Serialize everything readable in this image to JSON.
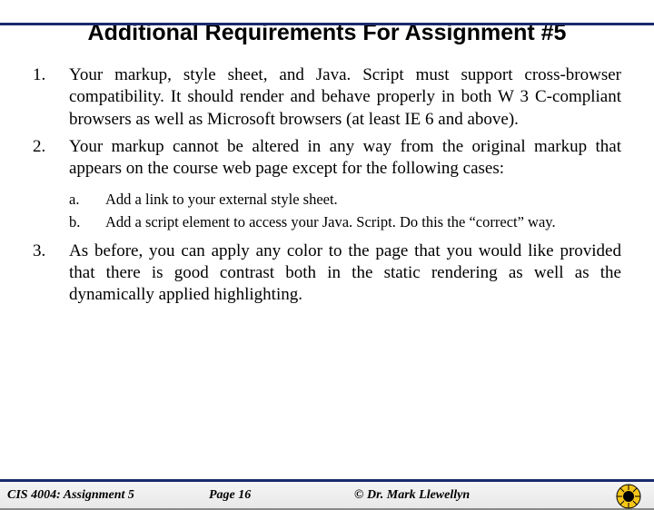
{
  "title": "Additional Requirements For Assignment #5",
  "items": [
    {
      "text": "Your markup, style sheet, and Java. Script must support cross-browser compatibility.  It should render and behave properly in both W 3 C-compliant browsers as well as Microsoft browsers (at least IE 6 and above)."
    },
    {
      "text": "Your markup cannot be altered in any way from the original markup that appears on the course web page except for the following cases:",
      "sub": [
        "Add a link to your external style sheet.",
        "Add a script element to access your Java. Script.  Do this the “correct” way."
      ]
    },
    {
      "text": "As before, you can apply any color to the page that you would like provided that there is good contrast both in the static rendering as well as the dynamically applied highlighting."
    }
  ],
  "footer": {
    "left": "CIS 4004:  Assignment 5",
    "center": "Page 16",
    "right": "© Dr. Mark Llewellyn"
  }
}
